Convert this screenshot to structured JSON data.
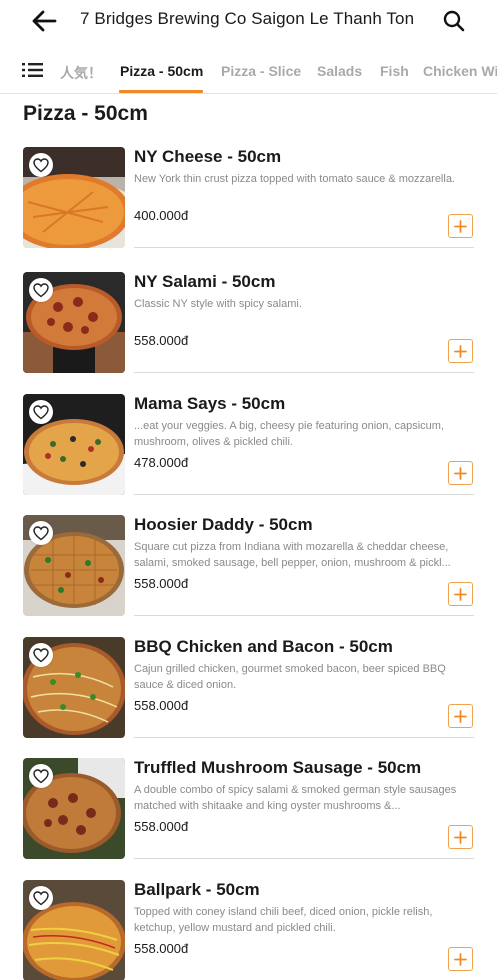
{
  "header": {
    "title": "7 Bridges Brewing Co Saigon Le Thanh Ton",
    "back_icon": "arrow-left-icon",
    "search_icon": "search-icon"
  },
  "tabs": [
    {
      "label": "人気！",
      "active": false
    },
    {
      "label": "Pizza - 50cm",
      "active": true
    },
    {
      "label": "Pizza - Slice",
      "active": false
    },
    {
      "label": "Salads",
      "active": false
    },
    {
      "label": "Fish",
      "active": false
    },
    {
      "label": "Chicken Wi",
      "active": false
    }
  ],
  "colors": {
    "accent": "#f08a24",
    "add_border": "#f0a24e",
    "muted": "#a9a9a9"
  },
  "section": {
    "title": "Pizza - 50cm"
  },
  "items": [
    {
      "name": "NY Cheese - 50cm",
      "desc": "New York thin crust pizza topped with tomato sauce & mozzarella.",
      "price": "400.000đ"
    },
    {
      "name": "NY Salami - 50cm",
      "desc": "Classic NY style with spicy salami.",
      "price": "558.000đ"
    },
    {
      "name": "Mama Says - 50cm",
      "desc": "...eat your veggies. A big, cheesy pie featuring onion, capsicum, mushroom, olives & pickled chili.",
      "price": "478.000đ"
    },
    {
      "name": "Hoosier Daddy - 50cm",
      "desc": "Square cut pizza from Indiana with mozarella & cheddar cheese, salami, smoked sausage, bell pepper, onion, mushroom & pickl...",
      "price": "558.000đ"
    },
    {
      "name": "BBQ Chicken and Bacon - 50cm",
      "desc": "Cajun grilled chicken, gourmet smoked bacon, beer spiced BBQ sauce & diced onion.",
      "price": "558.000đ"
    },
    {
      "name": "Truffled Mushroom Sausage - 50cm",
      "desc": "A double combo of spicy salami & smoked german style sausages matched with shitaake and king oyster mushrooms &...",
      "price": "558.000đ"
    },
    {
      "name": "Ballpark - 50cm",
      "desc": "Topped with coney island chili beef, diced onion, pickle relish, ketchup, yellow mustard and pickled chili.",
      "price": "558.000đ"
    }
  ]
}
